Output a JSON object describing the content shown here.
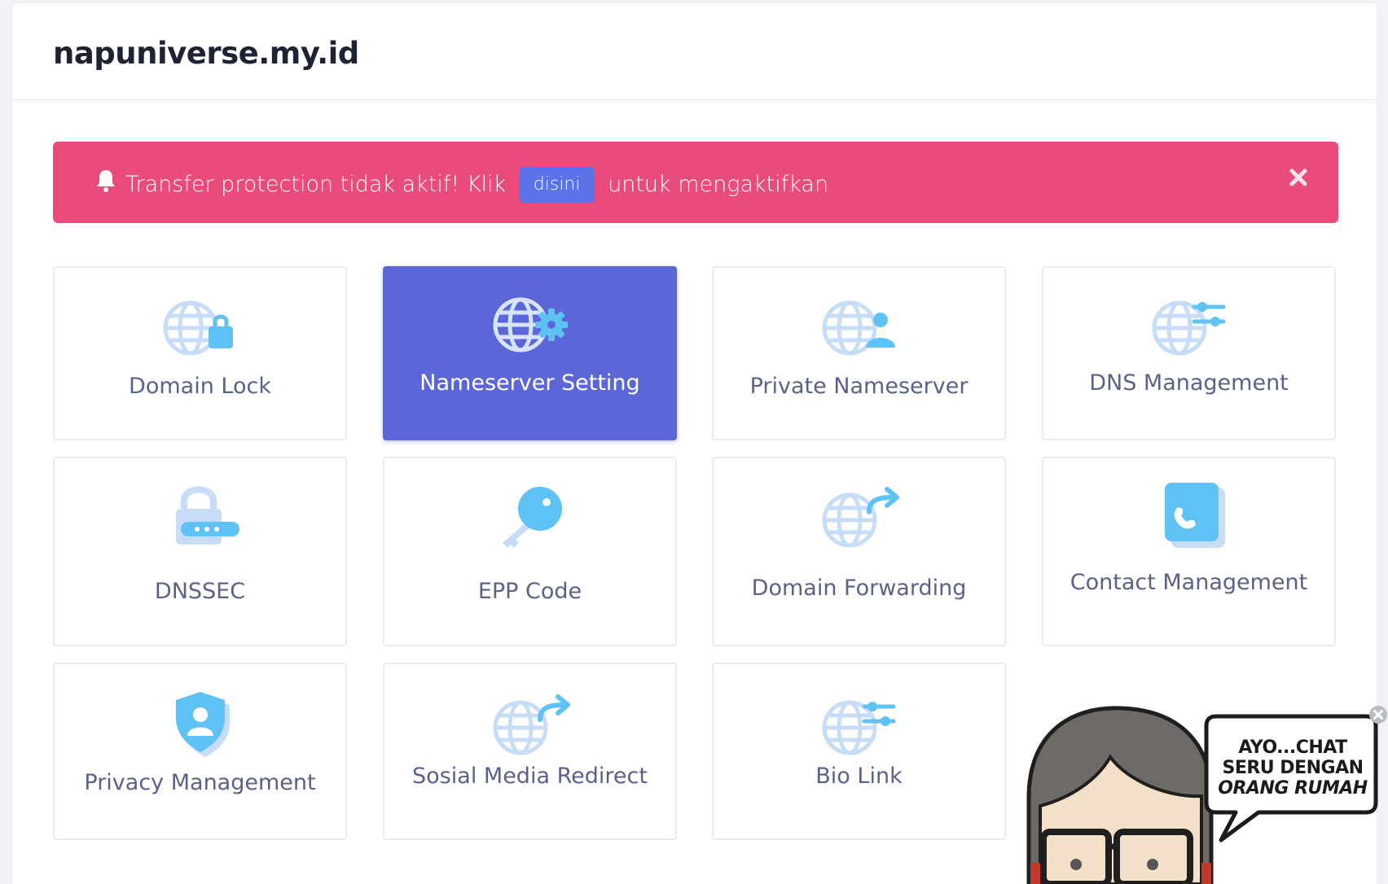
{
  "header": {
    "domain": "napuniverse.my.id"
  },
  "alert": {
    "text_before": "Transfer protection tidak aktif! Klik",
    "link_label": "disini",
    "text_after": "untuk mengaktifkan",
    "bell_icon": "bell-icon",
    "close_icon": "close-icon",
    "background": "#e94b7b",
    "link_color": "#5b73e8"
  },
  "tiles": [
    {
      "label": "Domain Lock",
      "icon": "globe-lock-icon",
      "active": false
    },
    {
      "label": "Nameserver Setting",
      "icon": "globe-gear-icon",
      "active": true
    },
    {
      "label": "Private Nameserver",
      "icon": "globe-user-icon",
      "active": false
    },
    {
      "label": "DNS Management",
      "icon": "globe-sliders-icon",
      "active": false
    },
    {
      "label": "DNSSEC",
      "icon": "padlock-dots-icon",
      "active": false
    },
    {
      "label": "EPP Code",
      "icon": "key-icon",
      "active": false
    },
    {
      "label": "Domain Forwarding",
      "icon": "globe-forward-icon",
      "active": false
    },
    {
      "label": "Contact Management",
      "icon": "phone-card-icon",
      "active": false
    },
    {
      "label": "Privacy Management",
      "icon": "shield-user-icon",
      "active": false
    },
    {
      "label": "Sosial Media Redirect",
      "icon": "globe-redirect-icon",
      "active": false
    },
    {
      "label": "Bio Link",
      "icon": "globe-sliders-icon",
      "active": false
    }
  ],
  "colors": {
    "active_tile": "#5b67d8",
    "icon_primary": "#5ec2f5",
    "icon_secondary": "#c6dcf7",
    "tile_label": "#5a6289"
  },
  "chat": {
    "line1": "AYO...CHAT",
    "line2": "SERU DENGAN",
    "line3": "ORANG RUMAH",
    "close_icon": "close-icon",
    "avatar_icon": "cartoon-avatar-icon"
  }
}
